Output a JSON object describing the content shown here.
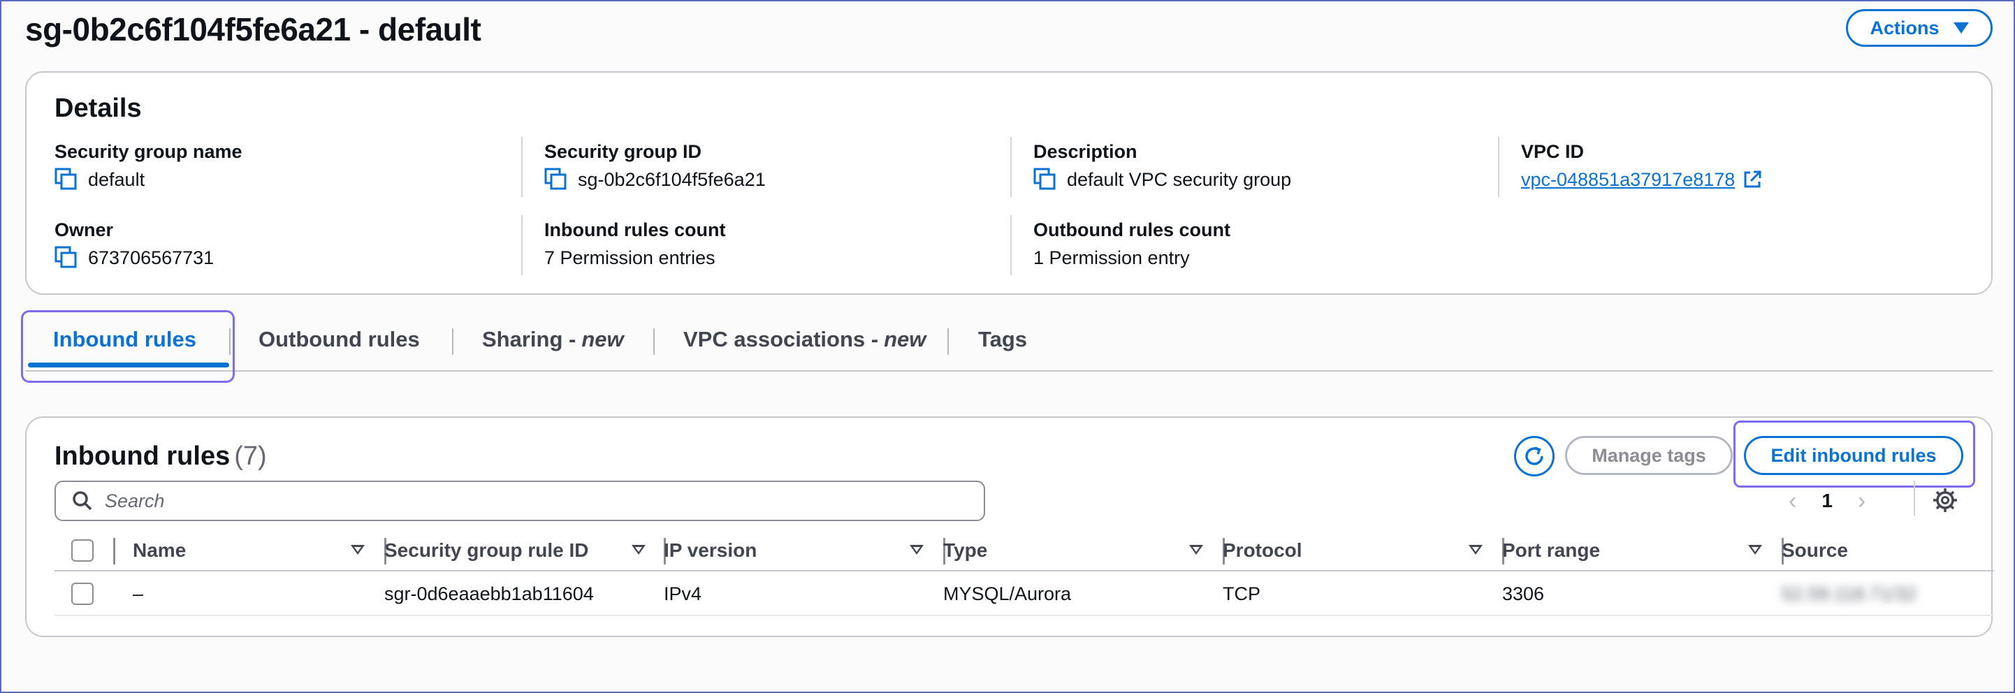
{
  "header": {
    "title": "sg-0b2c6f104f5fe6a21 - default",
    "actions_label": "Actions"
  },
  "details": {
    "heading": "Details",
    "fields": {
      "sg_name": {
        "label": "Security group name",
        "value": "default"
      },
      "sg_id": {
        "label": "Security group ID",
        "value": "sg-0b2c6f104f5fe6a21"
      },
      "description": {
        "label": "Description",
        "value": "default VPC security group"
      },
      "vpc_id": {
        "label": "VPC ID",
        "value": "vpc-048851a37917e8178"
      },
      "owner": {
        "label": "Owner",
        "value": "673706567731"
      },
      "inbound_count": {
        "label": "Inbound rules count",
        "value": "7 Permission entries"
      },
      "outbound_count": {
        "label": "Outbound rules count",
        "value": "1 Permission entry"
      }
    }
  },
  "tabs": [
    {
      "label": "Inbound rules",
      "suffix": ""
    },
    {
      "label": "Outbound rules",
      "suffix": ""
    },
    {
      "label": "Sharing - ",
      "suffix": "new"
    },
    {
      "label": "VPC associations - ",
      "suffix": "new"
    },
    {
      "label": "Tags",
      "suffix": ""
    }
  ],
  "rules": {
    "title": "Inbound rules",
    "count": "(7)",
    "manage_tags_label": "Manage tags",
    "edit_label": "Edit inbound rules",
    "search_placeholder": "Search",
    "page": "1",
    "columns": [
      "Name",
      "Security group rule ID",
      "IP version",
      "Type",
      "Protocol",
      "Port range",
      "Source"
    ],
    "rows": [
      {
        "name": "–",
        "rule_id": "sgr-0d6eaaebb1ab11604",
        "ip_version": "IPv4",
        "type": "MYSQL/Aurora",
        "protocol": "TCP",
        "port_range": "3306",
        "source": "52.59.118.71/32"
      }
    ]
  },
  "colors": {
    "accent": "#0972d3",
    "highlight": "#7b6cf0",
    "border": "#c6c6cd"
  },
  "icons": {
    "copy": "copy-icon",
    "external": "external-link-icon",
    "refresh": "refresh-icon",
    "search": "search-icon",
    "settings": "gear-icon",
    "caret": "caret-down-icon"
  }
}
